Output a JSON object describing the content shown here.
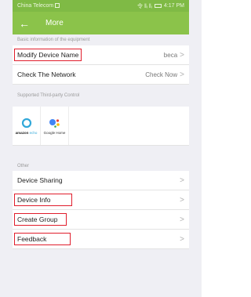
{
  "status": {
    "carrier": "China Telecom",
    "signal_text": "令 ‖ᵢ ‖ᵢ",
    "time": "4:17 PM"
  },
  "header": {
    "back_glyph": "←",
    "title": "More"
  },
  "sections": {
    "basic_info_label": "Basic information of the equipment",
    "third_party_label": "Supported Third-party Control",
    "other_label": "Other"
  },
  "rows": {
    "modify_name": {
      "label": "Modify Device Name",
      "value": "beca"
    },
    "check_network": {
      "label": "Check The Network",
      "value": "Check Now"
    },
    "device_sharing": {
      "label": "Device Sharing"
    },
    "device_info": {
      "label": "Device Info"
    },
    "create_group": {
      "label": "Create Group"
    },
    "feedback": {
      "label": "Feedback"
    }
  },
  "third_party": [
    {
      "brand": "amazon",
      "product": " echo",
      "icon": "amazon-echo-ring-icon"
    },
    {
      "label": "Google Home",
      "icon": "google-assistant-icon"
    }
  ],
  "icons": {
    "chevron": ">"
  },
  "colors": {
    "accent_green": "#8bc34a",
    "status_green": "#7fba45",
    "highlight_red": "#e01d2c",
    "background": "#efeff4"
  }
}
